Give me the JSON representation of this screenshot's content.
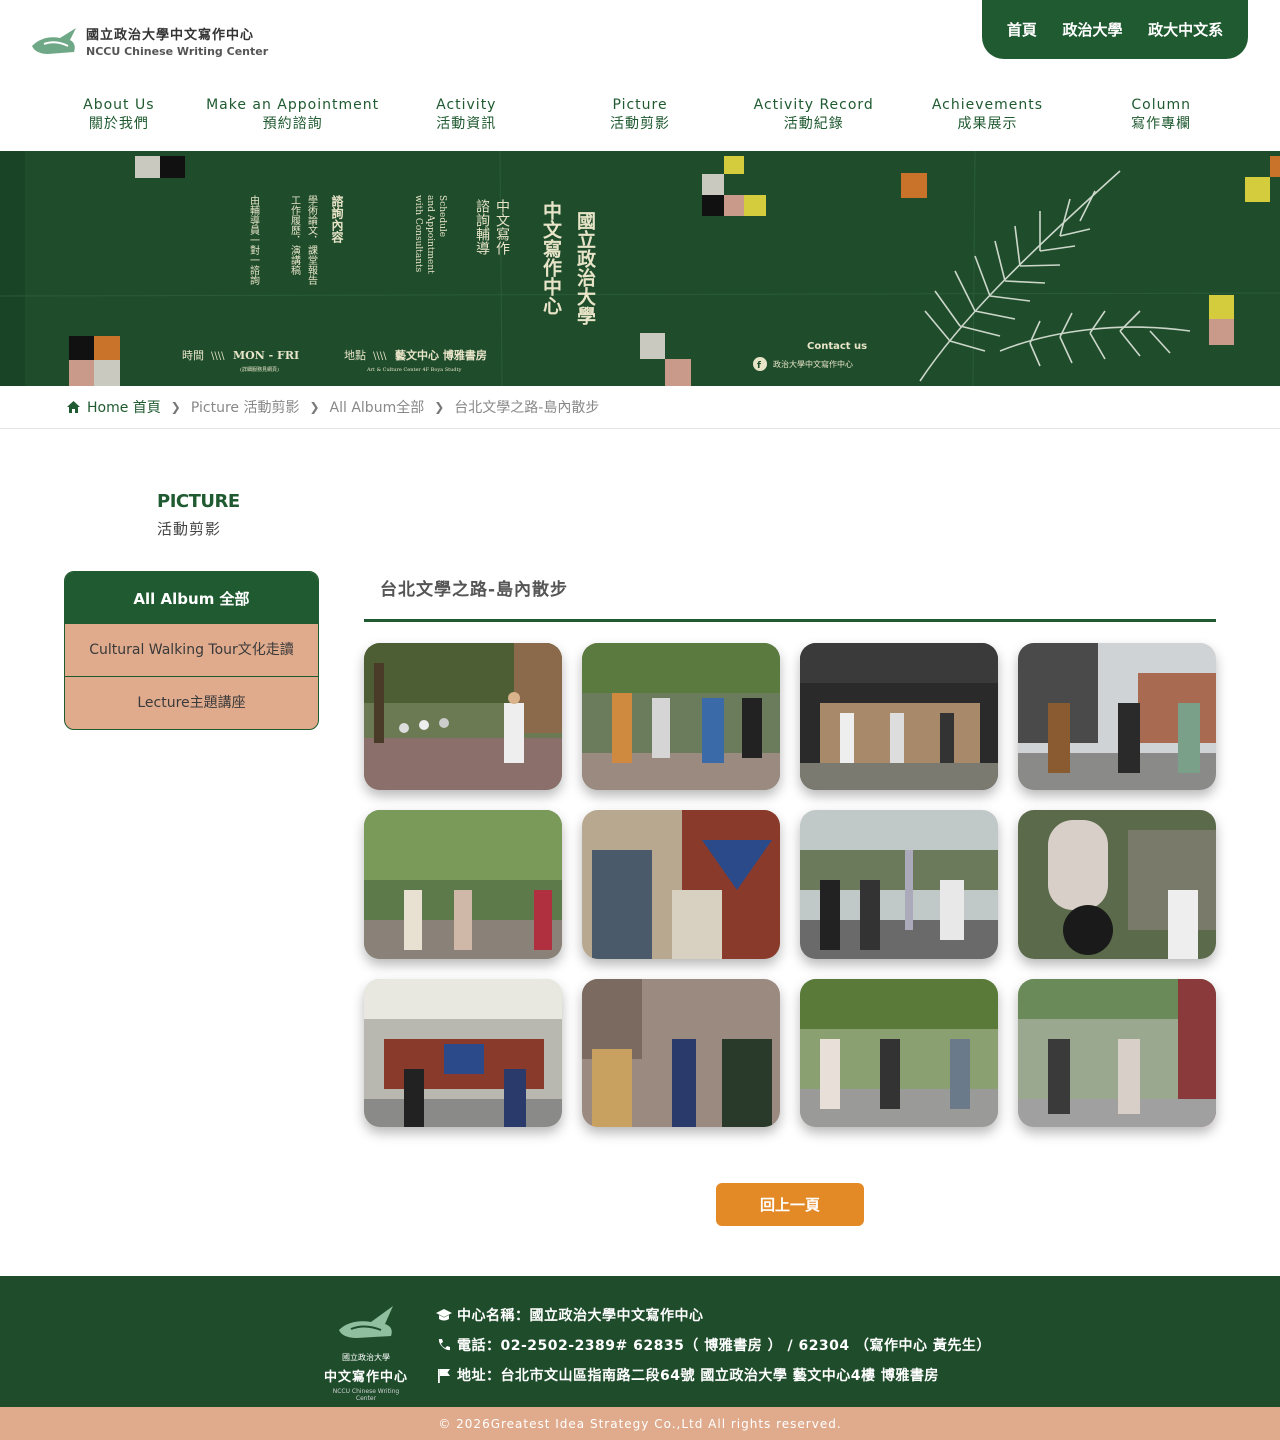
{
  "header": {
    "logo_zh": "國立政治大學中文寫作中心",
    "logo_en": "NCCU Chinese Writing Center",
    "top_links": [
      "首頁",
      "政治大學",
      "政大中文系"
    ],
    "nav": [
      {
        "en": "About Us",
        "zh": "關於我們"
      },
      {
        "en": "Make an Appointment",
        "zh": "預約諮詢"
      },
      {
        "en": "Activity",
        "zh": "活動資訊"
      },
      {
        "en": "Picture",
        "zh": "活動剪影"
      },
      {
        "en": "Activity Record",
        "zh": "活動紀錄"
      },
      {
        "en": "Achievements",
        "zh": "成果展示"
      },
      {
        "en": "Column",
        "zh": "寫作專欄"
      }
    ]
  },
  "banner": {
    "title_col1": "國立政治大學",
    "title_col2": "中文寫作中心",
    "sub_col1": "中文寫作",
    "sub_col2": "諮詢輔導",
    "en_col1": "Schedule",
    "en_col2": "and Appointment",
    "en_col3": "with Consultants",
    "content_col1": "諮詢內容",
    "content_col2": "學術論文．課堂報告",
    "content_col3": "工作履歷．演講稿",
    "content_col4": "由輔導員一對一諮詢",
    "time_label": "時間",
    "time_value": "MON - FRI",
    "time_note": "(詳細服務見網頁)",
    "place_label": "地點",
    "place_value": "藝文中心 博雅書房",
    "place_en": "Art & Culture Center 4F Boya Studty",
    "contact_label": "Contact us",
    "contact_fb": "政治大學中文寫作中心",
    "colors": {
      "green": "#1f4d2c",
      "accent_yellow": "#d4cc3c",
      "accent_orange": "#c8722a",
      "accent_pink": "#c99a8a"
    }
  },
  "breadcrumb": {
    "home": "Home 首頁",
    "items": [
      "Picture 活動剪影",
      "All Album全部",
      "台北文學之路-島內散步"
    ]
  },
  "section": {
    "en": "PICTURE",
    "zh": "活動剪影"
  },
  "sidebar": {
    "head": "All Album 全部",
    "items": [
      "Cultural Walking Tour文化走讀",
      "Lecture主題講座"
    ]
  },
  "album": {
    "title": "台北文學之路-島內散步",
    "photos": [
      "photo-1",
      "photo-2",
      "photo-3",
      "photo-4",
      "photo-5",
      "photo-6",
      "photo-7",
      "photo-8",
      "photo-9",
      "photo-10",
      "photo-11",
      "photo-12"
    ]
  },
  "back_button": "回上一頁",
  "footer": {
    "logo_l1": "國立政治大學",
    "logo_l2": "中文寫作中心",
    "logo_l3": "NCCU Chinese Writing Center",
    "name": "中心名稱：國立政治大學中文寫作中心",
    "phone": "電話：02-2502-2389# 62835（ 博雅書房 ） / 62304 （寫作中心 黃先生）",
    "address": "地址：台北市文山區指南路二段64號 國立政治大學 藝文中心4樓 博雅書房",
    "copyright": "© 2026Greatest Idea Strategy Co.,Ltd All rights reserved."
  }
}
